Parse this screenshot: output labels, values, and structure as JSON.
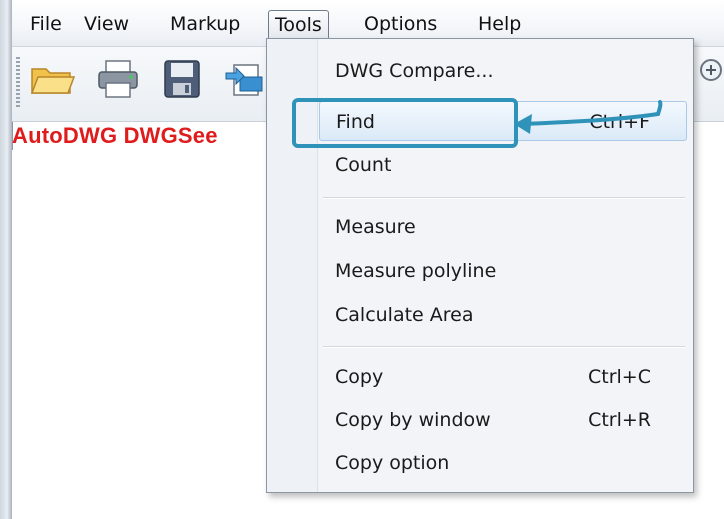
{
  "menubar": {
    "items": [
      "File",
      "View",
      "Markup",
      "Tools",
      "Options",
      "Help"
    ],
    "active_index": 3
  },
  "toolbar": {
    "icons": [
      "open-folder-icon",
      "print-icon",
      "save-icon",
      "export-icon",
      "zoom-in-icon"
    ]
  },
  "document": {
    "title": "AutoDWG DWGSee"
  },
  "tools_menu": {
    "items": [
      {
        "label": "DWG Compare...",
        "shortcut": ""
      },
      {
        "label": "Find",
        "shortcut": "Ctrl+F"
      },
      {
        "label": "Count",
        "shortcut": ""
      },
      {
        "label": "Measure",
        "shortcut": ""
      },
      {
        "label": "Measure polyline",
        "shortcut": ""
      },
      {
        "label": "Calculate Area",
        "shortcut": ""
      },
      {
        "label": "Copy",
        "shortcut": "Ctrl+C"
      },
      {
        "label": "Copy by window",
        "shortcut": "Ctrl+R"
      },
      {
        "label": "Copy option",
        "shortcut": ""
      }
    ],
    "highlighted_index": 1
  },
  "colors": {
    "title_red": "#e01b1b",
    "callout_blue": "#2f93b9"
  }
}
